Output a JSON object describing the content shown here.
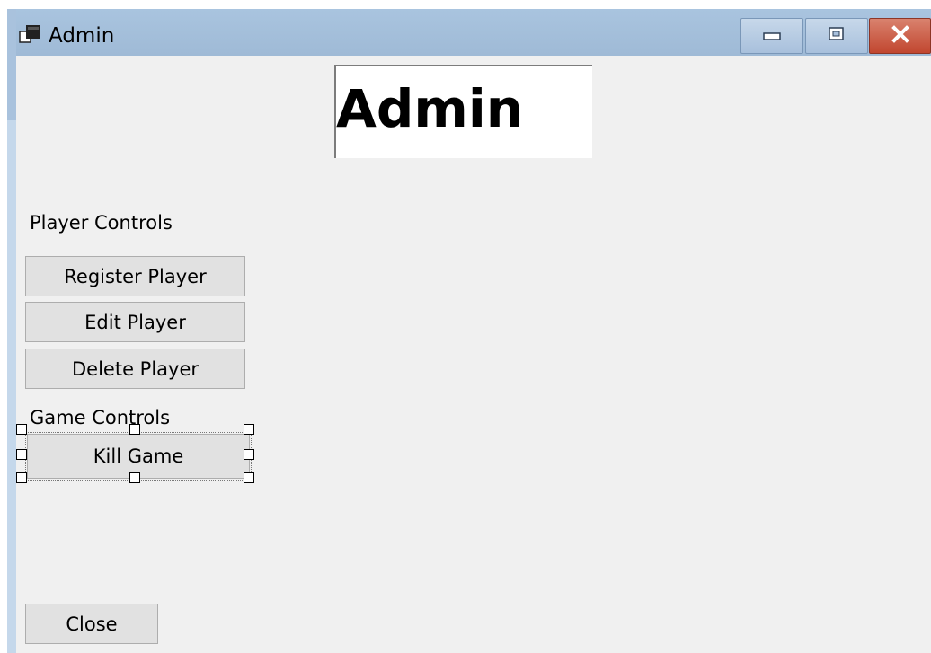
{
  "window": {
    "title": "Admin",
    "icon": "window-app-icon"
  },
  "caption_buttons": {
    "minimize": "minimize-icon",
    "maximize": "maximize-icon",
    "close": "close-icon"
  },
  "header": {
    "title": "Admin"
  },
  "player_controls": {
    "label": "Player Controls",
    "buttons": [
      "Register Player",
      "Edit Player",
      "Delete Player"
    ]
  },
  "game_controls": {
    "label": "Game Controls",
    "buttons": [
      "Kill Game"
    ]
  },
  "footer": {
    "close_label": "Close"
  },
  "colors": {
    "titlebar": "#a9c4df",
    "client": "#f0f0f0",
    "button": "#e1e1e1",
    "close_caption": "#c1462f"
  }
}
